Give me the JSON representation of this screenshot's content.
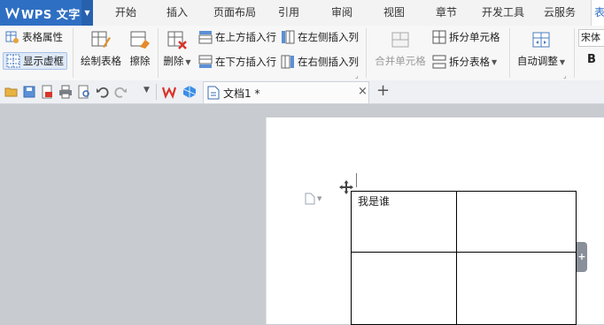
{
  "app": {
    "name": "WPS 文字"
  },
  "menu_tabs": [
    {
      "label": "开始"
    },
    {
      "label": "插入"
    },
    {
      "label": "页面布局"
    },
    {
      "label": "引用"
    },
    {
      "label": "审阅"
    },
    {
      "label": "视图"
    },
    {
      "label": "章节"
    },
    {
      "label": "开发工具"
    },
    {
      "label": "云服务"
    },
    {
      "label": "表"
    }
  ],
  "ribbon": {
    "table_properties": "表格属性",
    "show_gridlines": "显示虚框",
    "draw_table": "绘制表格",
    "erase": "擦除",
    "delete": "删除",
    "insert_row_above": "在上方插入行",
    "insert_row_below": "在下方插入行",
    "insert_col_left": "在左侧插入列",
    "insert_col_right": "在右侧插入列",
    "merge_cells": "合并单元格",
    "split_cells": "拆分单元格",
    "split_table": "拆分表格",
    "auto_fit": "自动调整",
    "font_name": "宋体",
    "bold": "B"
  },
  "doc_tab": {
    "title": "文档1 *",
    "close": "×",
    "new_tab": "+"
  },
  "document": {
    "cells": [
      [
        "我是谁",
        ""
      ],
      [
        "",
        ""
      ]
    ],
    "table_handle": "+"
  },
  "colors": {
    "brand": "#2f6fc3",
    "accent_red": "#d9342b"
  }
}
